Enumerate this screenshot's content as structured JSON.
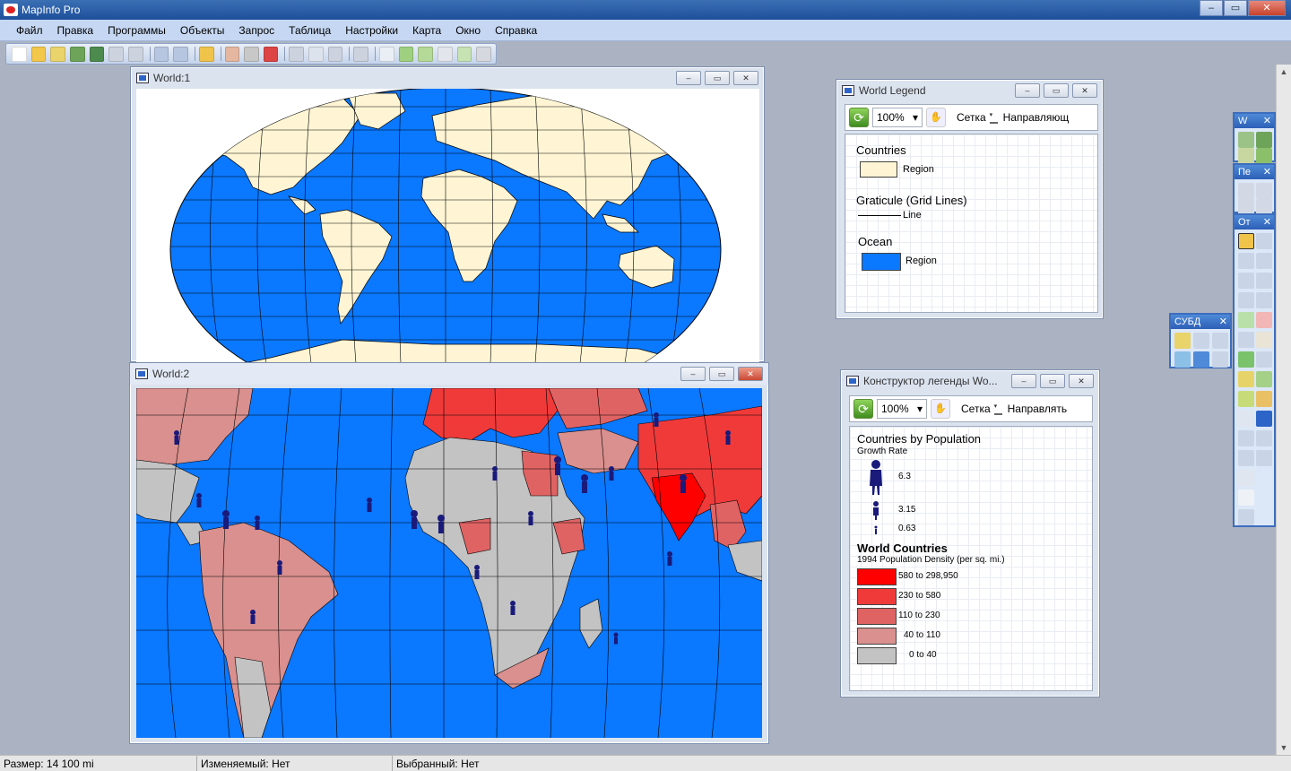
{
  "app": {
    "title": "MapInfo Pro"
  },
  "window_controls": {
    "minimize": "–",
    "maximize": "▭",
    "close": "✕"
  },
  "menu": [
    "Файл",
    "Правка",
    "Программы",
    "Объекты",
    "Запрос",
    "Таблица",
    "Настройки",
    "Карта",
    "Окно",
    "Справка"
  ],
  "colors": {
    "ocean": "#0a78ff",
    "land": "#fff5d4",
    "grid": "#000000",
    "pop_shade": [
      "#ff0000",
      "#f03a3a",
      "#e06363",
      "#d9908e",
      "#c3c3c3"
    ],
    "symbol": "#1a1a7a"
  },
  "windows": {
    "world1": {
      "title": "World:1"
    },
    "world2": {
      "title": "World:2"
    },
    "legend1": {
      "title": "World Legend",
      "zoom": "100%",
      "grid_label": "Сетка",
      "guides_label": "Направляющ",
      "layers": [
        {
          "name": "Countries",
          "item": "Region"
        },
        {
          "name": "Graticule (Grid Lines)",
          "item": "Line"
        },
        {
          "name": "Ocean",
          "item": "Region"
        }
      ]
    },
    "legend2": {
      "title": "Конструктор легенды Wo...",
      "zoom": "100%",
      "grid_label": "Сетка",
      "guides_label": "Направлять",
      "growth": {
        "title": "Countries by Population",
        "subtitle": "Growth Rate",
        "values": [
          "6.3",
          "3.15",
          "0.63"
        ]
      },
      "density": {
        "title": "World Countries",
        "subtitle": "1994 Population Density (per sq. mi.)",
        "ranges": [
          "580  to  298,950",
          "230  to  580",
          "110  to  230",
          "40  to  110",
          "0  to  40"
        ]
      }
    }
  },
  "tool_palettes": {
    "main": {
      "title": "W"
    },
    "draw": {
      "title": "Пе"
    },
    "ops": {
      "title": "От"
    },
    "dbms": {
      "title": "СУБД"
    }
  },
  "status": {
    "size": "Размер: 14 100 mi",
    "editable": "Изменяемый: Нет",
    "selected": "Выбранный: Нет"
  }
}
